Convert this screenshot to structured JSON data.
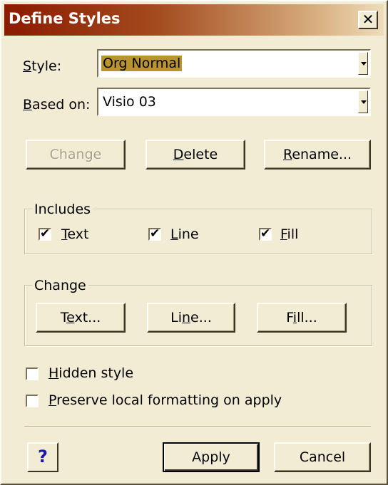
{
  "window": {
    "title": "Define Styles",
    "close_glyph": "✕"
  },
  "style_field": {
    "label_key": "S",
    "label_rest": "tyle:",
    "value": "Org Normal"
  },
  "based_on_field": {
    "label_key": "B",
    "label_rest": "ased on:",
    "value": "Visio 03"
  },
  "top_buttons": {
    "change": {
      "pre": "Chan",
      "key": "g",
      "post": "e"
    },
    "delete": {
      "pre": "",
      "key": "D",
      "post": "elete"
    },
    "rename": {
      "pre": "",
      "key": "R",
      "post": "ename..."
    }
  },
  "includes": {
    "legend": "Includes",
    "text": {
      "key": "T",
      "rest": "ext",
      "checked": true
    },
    "line": {
      "key": "L",
      "rest": "ine",
      "checked": true
    },
    "fill": {
      "key": "F",
      "rest": "ill",
      "checked": true
    }
  },
  "change_group": {
    "legend": "Change",
    "text_btn": {
      "pre": "T",
      "key": "e",
      "post": "xt..."
    },
    "line_btn": {
      "pre": "Li",
      "key": "n",
      "post": "e..."
    },
    "fill_btn": {
      "pre": "F",
      "key": "i",
      "post": "ll..."
    }
  },
  "options": {
    "hidden": {
      "key": "H",
      "rest": "idden style",
      "checked": false
    },
    "preserve": {
      "key": "P",
      "rest": "reserve local formatting on apply",
      "checked": false
    }
  },
  "footer": {
    "help_label": "?",
    "apply_label": "Apply",
    "cancel_label": "Cancel"
  },
  "colors": {
    "dialog_bg": "#f3ecd5",
    "title_start": "#8a1b00",
    "title_end": "#eedcb9",
    "selection": "#b8932f"
  },
  "icons": {
    "check": "✔",
    "help": "question-mark-icon"
  }
}
